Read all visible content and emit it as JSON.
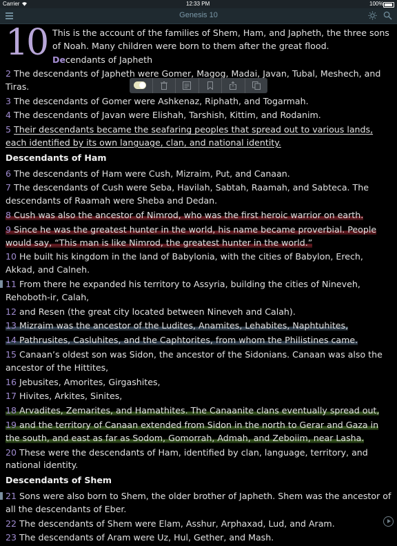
{
  "status": {
    "carrier": "Carrier",
    "time": "12:33 PM",
    "battery": "100%"
  },
  "nav": {
    "title": "Genesis 10"
  },
  "chapter": {
    "number": "10",
    "intro": "This is the account of the families of Shem, Ham, and Japheth, the three sons of Noah. Many children were born to them after the great flood.",
    "drop_heading_bold": "De",
    "drop_heading_rest": "cendants of Japheth"
  },
  "verses_a": [
    {
      "n": "2",
      "t": "The descendants of Japheth were Gomer, Magog, Madai, Javan, Tubal, Meshech, and Tiras."
    },
    {
      "n": "3",
      "t": "The descendants of Gomer were Ashkenaz, Riphath, and Togarmah."
    },
    {
      "n": "4",
      "t": "The descendants of Javan were Elishah, Tarshish, Kittim, and Rodanim."
    },
    {
      "n": "5",
      "t": "Their descendants became the seafaring peoples that spread out to various lands, each identified by its own language, clan, and national identity."
    }
  ],
  "heading_ham": "Descendants of Ham",
  "verses_b": [
    {
      "n": "6",
      "t": "The descendants of Ham were Cush, Mizraim, Put, and Canaan."
    },
    {
      "n": "7",
      "t": "The descendants of Cush were Seba, Havilah, Sabtah, Raamah, and Sabteca. The descendants of Raamah were Sheba and Dedan."
    },
    {
      "n": "8",
      "t": "Cush was also the ancestor of Nimrod, who was the first heroic warrior on earth."
    },
    {
      "n": "9",
      "t": "Since he was the greatest hunter in the world, his name became proverbial. People would say, “This man is like Nimrod, the greatest hunter in the world.”"
    },
    {
      "n": "10",
      "t": "He built his kingdom in the land of Babylonia, with the cities of Babylon, Erech, Akkad, and Calneh."
    },
    {
      "n": "11",
      "t": "From there he expanded his territory to Assyria, building the cities of Nineveh, Rehoboth-ir, Calah,"
    },
    {
      "n": "12",
      "t": "and Resen (the great city located between Nineveh and Calah)."
    },
    {
      "n": "13",
      "t": "Mizraim was the ancestor of the Ludites, Anamites, Lehabites, Naphtuhites,"
    },
    {
      "n": "14",
      "t": "Pathrusites, Casluhites, and the Caphtorites, from whom the Philistines came."
    },
    {
      "n": "15",
      "t": "Canaan’s oldest son was Sidon, the ancestor of the Sidonians. Canaan was also the ancestor of the Hittites,"
    },
    {
      "n": "16",
      "t": "Jebusites, Amorites, Girgashites,"
    },
    {
      "n": "17",
      "t": "Hivites, Arkites, Sinites,"
    },
    {
      "n": "18",
      "t": "Arvadites, Zemarites, and Hamathites. The Canaanite clans eventually spread out,"
    },
    {
      "n": "19",
      "t": "and the territory of Canaan extended from Sidon in the north to Gerar and Gaza in the south, and east as far as Sodom, Gomorrah, Admah, and Zeboiim, near Lasha."
    },
    {
      "n": "20",
      "t": "These were the descendants of Ham, identified by clan, language, territory, and national identity."
    }
  ],
  "heading_shem": "Descendants of Shem",
  "verses_c": [
    {
      "n": "21",
      "t": "Sons were also born to Shem, the older brother of Japheth. Shem was the ancestor of all the descendants of Eber."
    },
    {
      "n": "22",
      "t": "The descendants of Shem were Elam, Asshur, Arphaxad, Lud, and Aram."
    },
    {
      "n": "23",
      "t": "The descendants of Aram were Uz, Hul, Gether, and Mash."
    }
  ],
  "icons": {
    "menu": "menu-icon",
    "brightness": "brightness-icon",
    "search": "search-icon",
    "toolbar": [
      "highlight-toggle-icon",
      "trash-icon",
      "note-icon",
      "bookmark-icon",
      "share-icon",
      "copy-icon"
    ],
    "audio": "play-icon"
  },
  "colors": {
    "highlight_red": "#96283a",
    "highlight_blue": "#465a6e",
    "highlight_green": "#466e28",
    "verse_number": "#a08bd0"
  }
}
